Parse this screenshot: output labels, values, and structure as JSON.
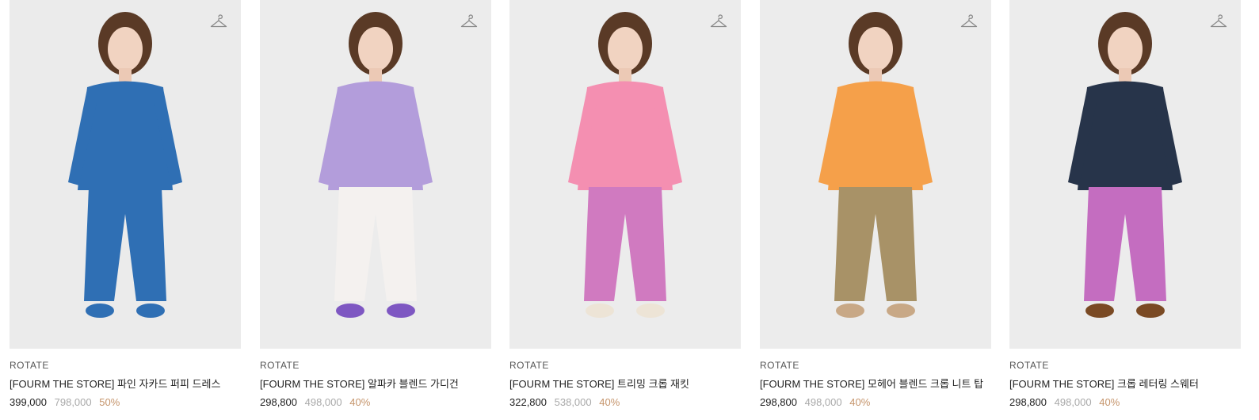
{
  "products": [
    {
      "brand": "ROTATE",
      "name": "[FOURM THE STORE] 파인 자카드 퍼피 드레스",
      "price": "399,000",
      "original_price": "798,000",
      "discount": "50%",
      "bg": "#ebebeb",
      "top_color": "#2f6fb4",
      "bottom_color": "#2f6fb4",
      "shoe_color": "#2f6fb4"
    },
    {
      "brand": "ROTATE",
      "name": "[FOURM THE STORE] 알파카 블렌드 가디건",
      "price": "298,800",
      "original_price": "498,000",
      "discount": "40%",
      "bg": "#ececec",
      "top_color": "#b39ddb",
      "bottom_color": "#f4f1ef",
      "shoe_color": "#7e57c2"
    },
    {
      "brand": "ROTATE",
      "name": "[FOURM THE STORE] 트리밍 크롭 재킷",
      "price": "322,800",
      "original_price": "538,000",
      "discount": "40%",
      "bg": "#ececec",
      "top_color": "#f48fb1",
      "bottom_color": "#d07ac0",
      "shoe_color": "#ede4d6"
    },
    {
      "brand": "ROTATE",
      "name": "[FOURM THE STORE] 모헤어 블렌드 크롭 니트 탑",
      "price": "298,800",
      "original_price": "498,000",
      "discount": "40%",
      "bg": "#ececec",
      "top_color": "#f5a04a",
      "bottom_color": "#a89267",
      "shoe_color": "#c8a886"
    },
    {
      "brand": "ROTATE",
      "name": "[FOURM THE STORE] 크롭 레터링 스웨터",
      "price": "298,800",
      "original_price": "498,000",
      "discount": "40%",
      "bg": "#ececec",
      "top_color": "#27344a",
      "bottom_color": "#c46dc0",
      "shoe_color": "#7a4a24"
    }
  ],
  "colors": {
    "discount": "#c5946b",
    "original_price": "#a9a9a9"
  },
  "icons": {
    "wishlist": "hanger-icon"
  }
}
